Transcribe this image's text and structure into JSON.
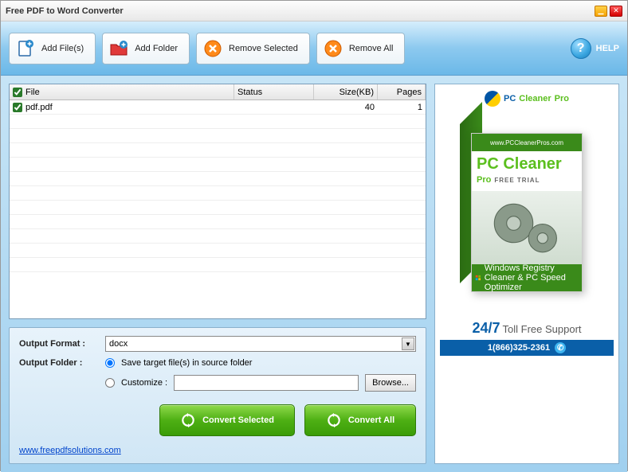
{
  "window": {
    "title": "Free PDF to Word Converter"
  },
  "toolbar": {
    "add_files": "Add File(s)",
    "add_folder": "Add Folder",
    "remove_selected": "Remove Selected",
    "remove_all": "Remove All",
    "help": "HELP"
  },
  "table": {
    "headers": {
      "file": "File",
      "status": "Status",
      "size": "Size(KB)",
      "pages": "Pages"
    },
    "rows": [
      {
        "checked": true,
        "file": "pdf.pdf",
        "status": "",
        "size": "40",
        "pages": "1"
      }
    ]
  },
  "output": {
    "format_label": "Output Format :",
    "format_value": "docx",
    "folder_label": "Output Folder :",
    "save_source": "Save target file(s) in source folder",
    "customize": "Customize :",
    "browse": "Browse...",
    "custom_path": ""
  },
  "actions": {
    "convert_selected": "Convert Selected",
    "convert_all": "Convert All"
  },
  "footer": {
    "link": "www.freepdfsolutions.com"
  },
  "ad": {
    "brand_pc": "PC",
    "brand_cleaner": "Cleaner",
    "brand_pro": "Pro",
    "box_url": "www.PCCleanerPros.com",
    "box_l1": "PC Cleaner",
    "box_l2": "Pro",
    "box_trial": "FREE TRIAL",
    "box_footer": "Windows Registry Cleaner & PC Speed Optimizer",
    "support_247": "24/7",
    "support_text": "Toll Free Support",
    "phone": "1(866)325-2361"
  }
}
